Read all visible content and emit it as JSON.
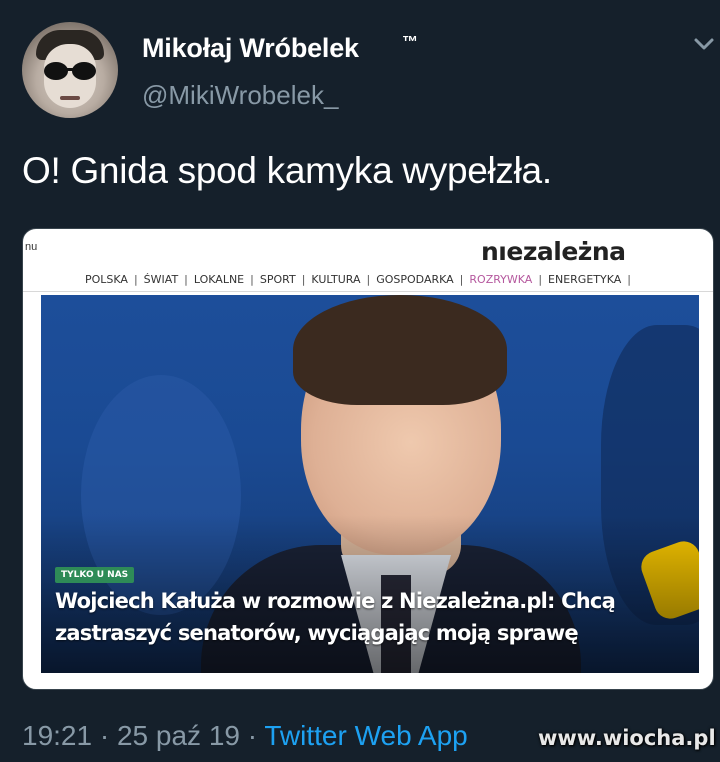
{
  "tweet": {
    "author_name": "Mikołaj Wróbelek",
    "author_badge": "™",
    "handle": "@MikiWrobelek_",
    "text": "O! Gnida spod kamyka wypełzła.",
    "time": "19:21",
    "date": "25 paź 19",
    "separator": "·",
    "app": "Twitter Web App"
  },
  "card": {
    "left_cut_text": "nu",
    "site_logo": "nıezależna",
    "nav": [
      "POLSKA",
      "ŚWIAT",
      "LOKALNE",
      "SPORT",
      "KULTURA",
      "GOSPODARKA",
      "ROZRYWKA",
      "ENERGETYKA"
    ],
    "nav_active": "ROZRYWKA",
    "badge": "TYLKO U NAS",
    "headline": "Wojciech Kałuża w rozmowie z Niezależna.pl: Chcą zastraszyć senatorów, wyciągając moją sprawę"
  },
  "watermark": "www.wiocha.pl",
  "colors": {
    "background": "#15202b",
    "secondary_text": "#8899a6",
    "link": "#1da1f2",
    "badge": "#2e8b57",
    "nav_active": "#b5589e"
  },
  "icons": {
    "more": "chevron-down-icon"
  }
}
